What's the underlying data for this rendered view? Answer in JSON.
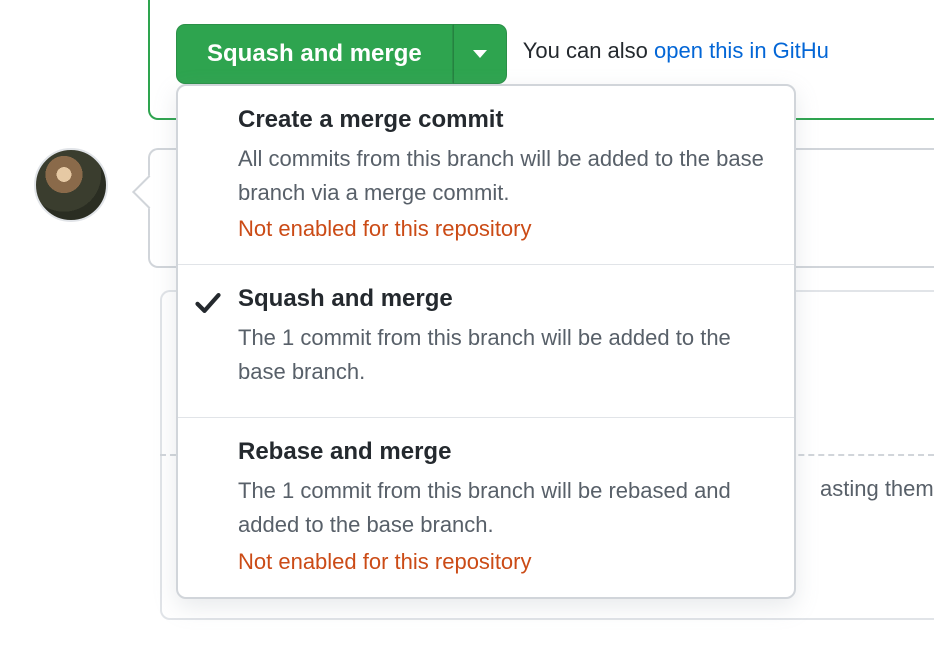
{
  "merge": {
    "button_label": "Squash and merge",
    "also_text": "You can also ",
    "also_link": "open this in GitHu"
  },
  "hint": {
    "pasting": "asting them"
  },
  "dropdown": {
    "options": [
      {
        "title": "Create a merge commit",
        "desc": "All commits from this branch will be added to the base branch via a merge commit.",
        "warning": "Not enabled for this repository",
        "selected": false
      },
      {
        "title": "Squash and merge",
        "desc": "The 1 commit from this branch will be added to the base branch.",
        "warning": "",
        "selected": true
      },
      {
        "title": "Rebase and merge",
        "desc": "The 1 commit from this branch will be rebased and added to the base branch.",
        "warning": "Not enabled for this repository",
        "selected": false
      }
    ]
  }
}
